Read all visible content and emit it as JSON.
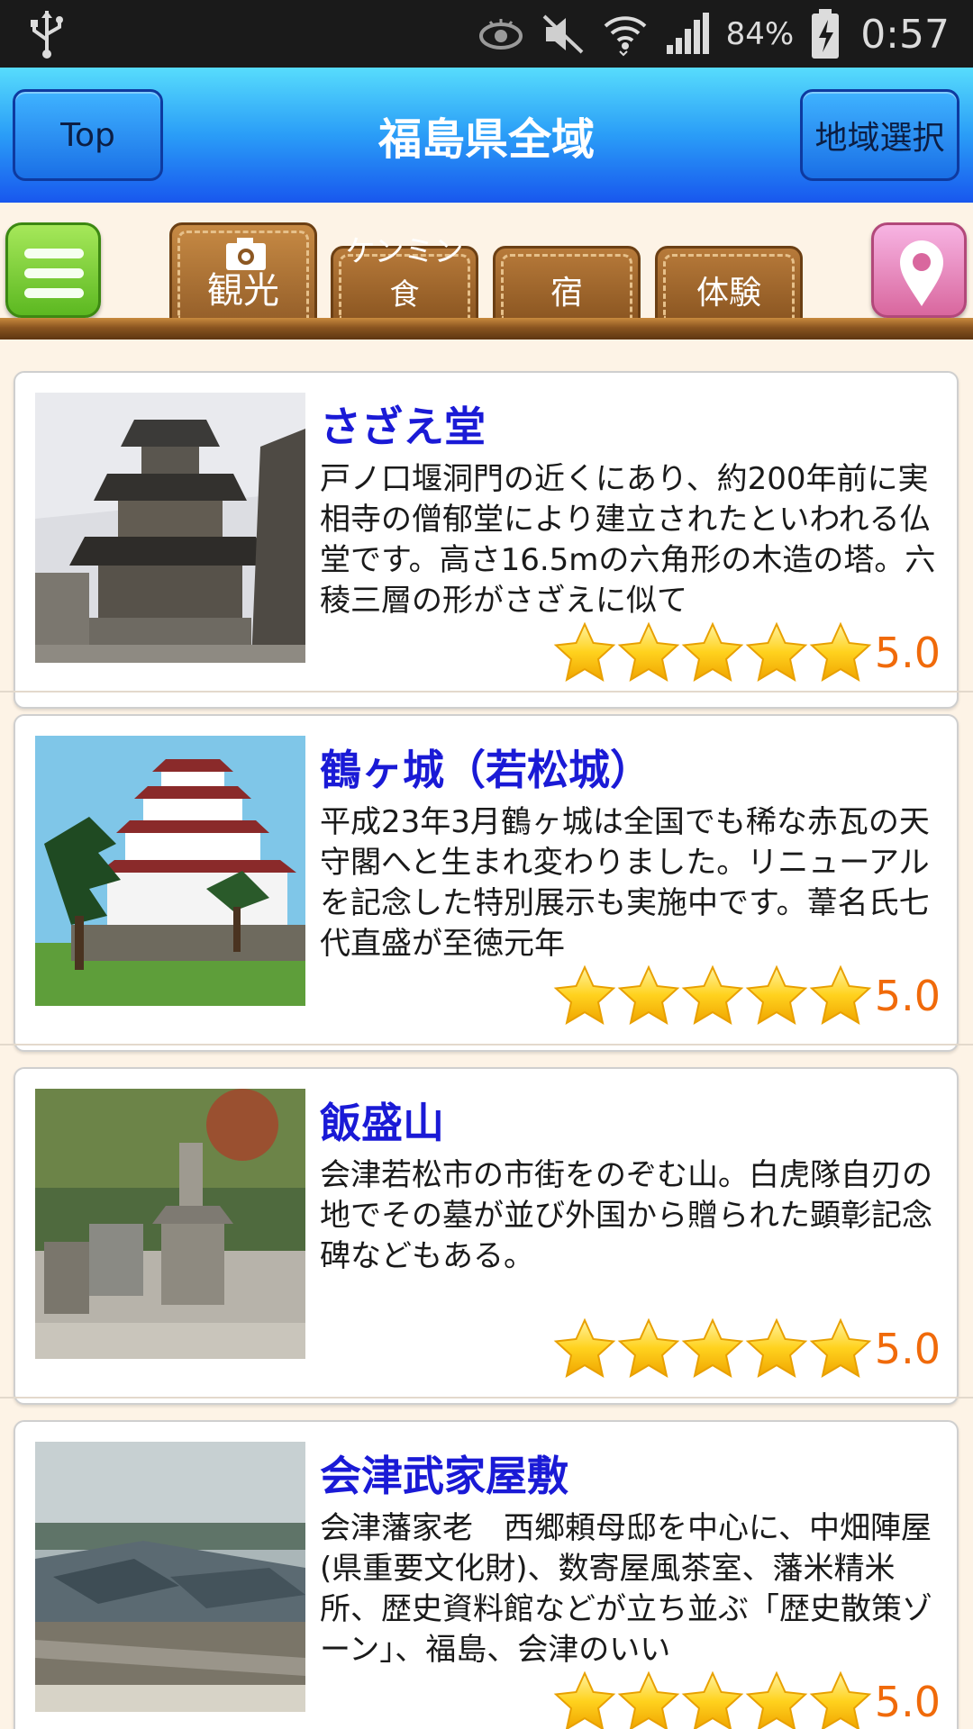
{
  "status_bar": {
    "battery_percent": "84%",
    "time": "0:57"
  },
  "header": {
    "top_button": "Top",
    "title": "福島県全域",
    "region_button": "地域選択"
  },
  "tabs": [
    {
      "label": "観光",
      "active": true
    },
    {
      "label": "ケンミン食",
      "active": false
    },
    {
      "label": "宿",
      "active": false
    },
    {
      "label": "体験",
      "active": false
    }
  ],
  "spots": [
    {
      "name": "さざえ堂",
      "description": "戸ノ口堰洞門の近くにあり、約200年前に実相寺の僧郁堂により建立されたといわれる仏堂です。高さ16.5mの六角形の木造の塔。六稜三層の形がさざえに似て",
      "rating": "5.0",
      "stars": 5
    },
    {
      "name": "鶴ヶ城（若松城）",
      "description": "平成23年3月鶴ヶ城は全国でも稀な赤瓦の天守閣へと生まれ変わりました。リニューアルを記念した特別展示も実施中です。葦名氏七代直盛が至徳元年",
      "rating": "5.0",
      "stars": 5
    },
    {
      "name": "飯盛山",
      "description": "会津若松市の市街をのぞむ山。白虎隊自刃の地でその墓が並び外国から贈られた顕彰記念碑などもある。",
      "rating": "5.0",
      "stars": 5
    },
    {
      "name": "会津武家屋敷",
      "description": "会津藩家老　西郷頼母邸を中心に、中畑陣屋(県重要文化財)、数寄屋風茶室、藩米精米所、歴史資料館などが立ち並ぶ「歴史散策ゾーン」、福島、会津のいい",
      "rating": "5.0",
      "stars": 5
    }
  ],
  "colors": {
    "header_top": "#57dcfc",
    "header_bottom": "#1857ee",
    "spot_name": "#1a1ad6",
    "rating_text": "#f06a0a",
    "tab_brown": "#8c5722",
    "star": "#ffc21a"
  }
}
